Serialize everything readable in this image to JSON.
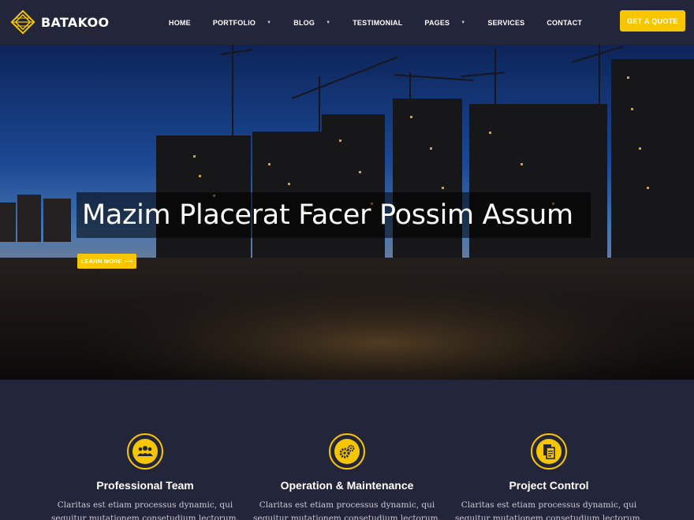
{
  "brand": {
    "name": "BATAKOO",
    "logo_icon": "diamond-grid-logo"
  },
  "nav": {
    "items": [
      {
        "label": "HOME",
        "has_dropdown": false
      },
      {
        "label": "PORTFOLIO",
        "has_dropdown": true
      },
      {
        "label": "BLOG",
        "has_dropdown": true
      },
      {
        "label": "TESTIMONIAL",
        "has_dropdown": false
      },
      {
        "label": "PAGES",
        "has_dropdown": true
      },
      {
        "label": "SERVICES",
        "has_dropdown": false
      },
      {
        "label": "CONTACT",
        "has_dropdown": false
      }
    ],
    "cta": "GET A QUOTE"
  },
  "hero": {
    "title": "Mazim Placerat Facer Possim Assum",
    "button": "LEARN MORE ⟶",
    "image": "construction-site-night"
  },
  "features": [
    {
      "icon": "team-icon",
      "title": "Professional Team",
      "line1": "Claritas est etiam processus dynamic, qui",
      "line2": "sequitur mutationem consetudium lectorum."
    },
    {
      "icon": "gears-icon",
      "title": "Operation & Maintenance",
      "line1": "Claritas est etiam processus dynamic, qui",
      "line2": "sequitur mutationem consetudium lectorum."
    },
    {
      "icon": "documents-icon",
      "title": "Project Control",
      "line1": "Claritas est etiam processus dynamic, qui",
      "line2": "sequitur mutationem consetudium lectorum."
    }
  ],
  "colors": {
    "accent": "#f7c600",
    "background": "#23263a",
    "text": "#ffffff",
    "muted": "#c8c9d4"
  }
}
